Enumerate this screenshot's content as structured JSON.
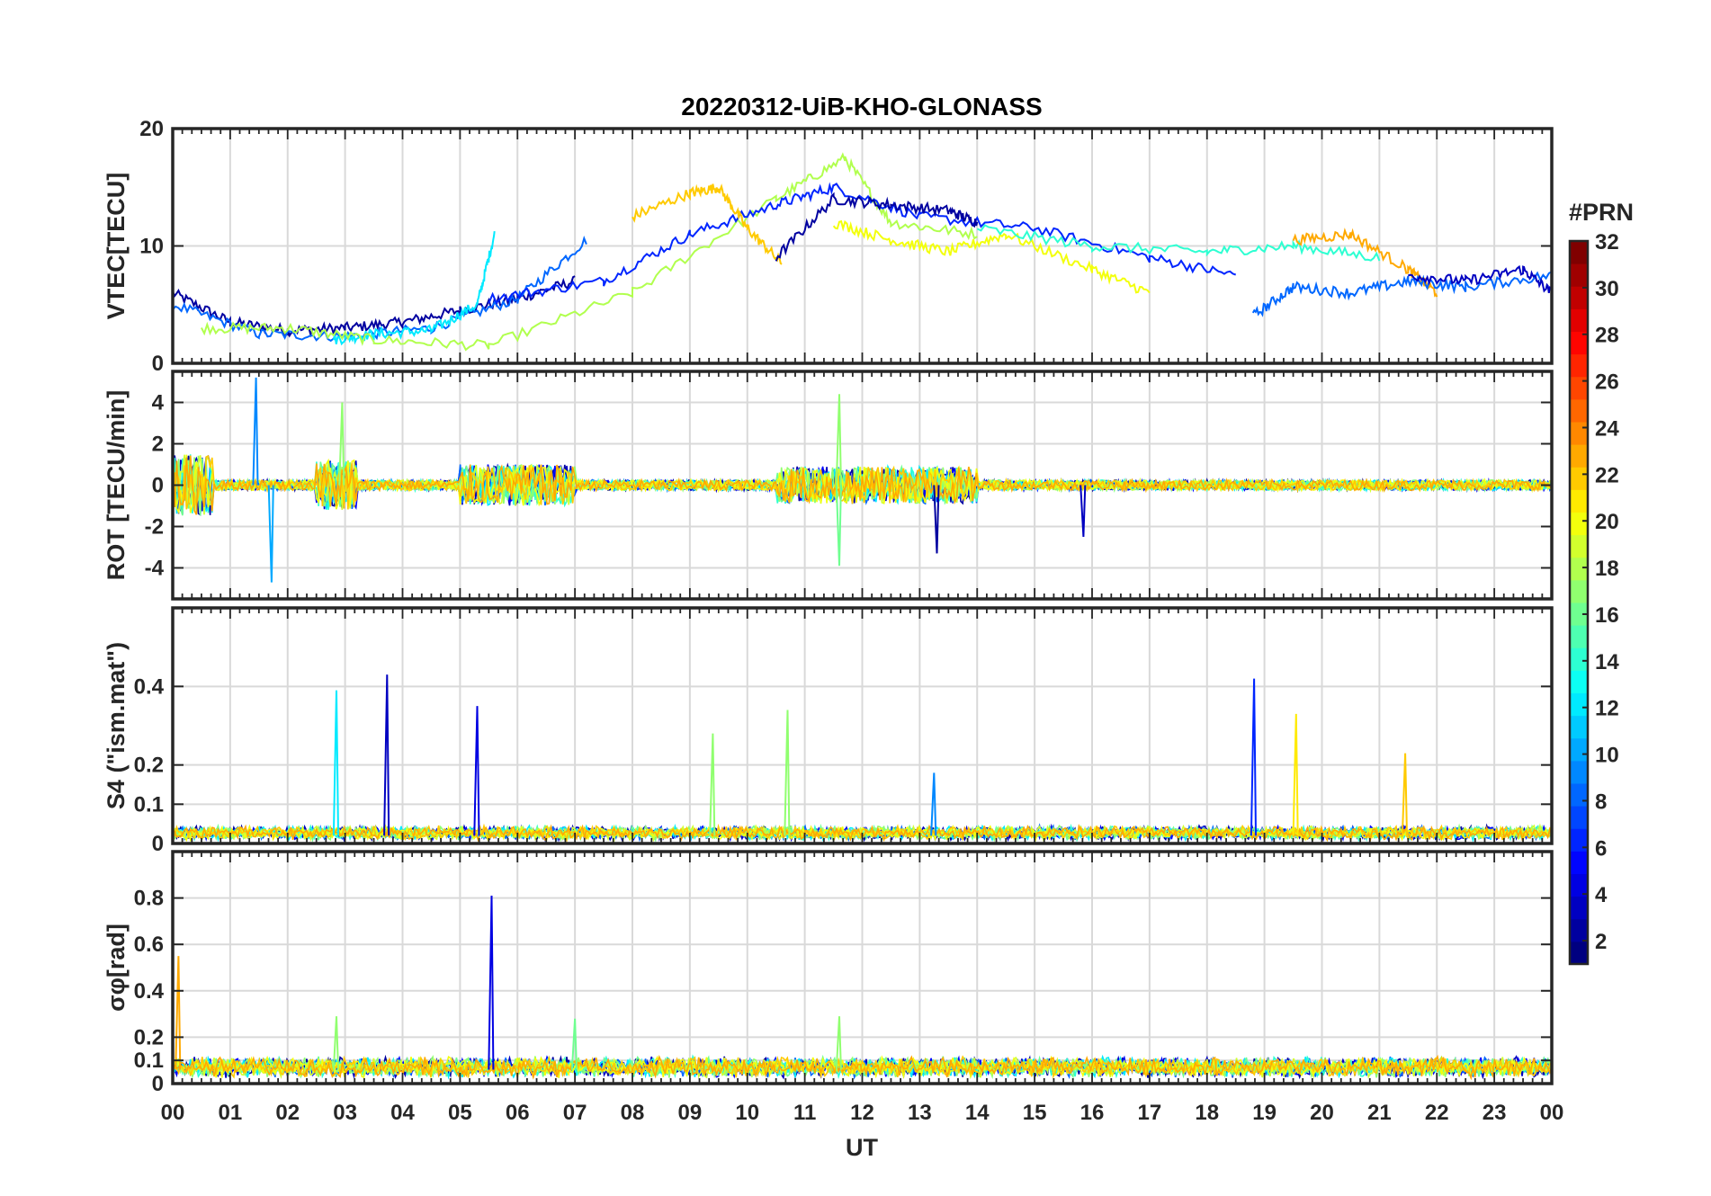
{
  "chart_data": {
    "type": "line",
    "title": "20220312-UiB-KHO-GLONASS",
    "xlabel": "UT",
    "x_tick_labels": [
      "00",
      "01",
      "02",
      "03",
      "04",
      "05",
      "06",
      "07",
      "08",
      "09",
      "10",
      "11",
      "12",
      "13",
      "14",
      "15",
      "16",
      "17",
      "18",
      "19",
      "20",
      "21",
      "22",
      "23",
      "00"
    ],
    "xlim_hours": [
      0,
      24
    ],
    "grid": true,
    "colorbar": {
      "label": "#PRN",
      "range": [
        1,
        32
      ],
      "tick_labels": [
        "2",
        "4",
        "6",
        "8",
        "10",
        "12",
        "14",
        "16",
        "18",
        "20",
        "22",
        "24",
        "26",
        "28",
        "30",
        "32"
      ],
      "colormap": "jet"
    },
    "panels": [
      {
        "id": "vtec",
        "ylabel": "VTEC[TECU]",
        "ylim": [
          0,
          20
        ],
        "y_ticks": [
          0,
          10,
          20
        ],
        "y_tick_labels": [
          "0",
          "10",
          "20"
        ],
        "series_shape": [
          {
            "prn": 2,
            "x": [
              0.0,
              1.0,
              2.0,
              3.0,
              4.0,
              5.0,
              6.0,
              7.0
            ],
            "y": [
              6,
              3.5,
              2.8,
              3.0,
              3.5,
              4.5,
              5.5,
              7
            ]
          },
          {
            "prn": 8,
            "x": [
              0.0,
              1.5,
              3.0,
              4.5,
              6.0,
              7.2
            ],
            "y": [
              5,
              2.5,
              2.3,
              3.0,
              5.5,
              10.5
            ]
          },
          {
            "prn": 12,
            "x": [
              2.8,
              3.5,
              4.5,
              5.3,
              5.6
            ],
            "y": [
              2.0,
              2.5,
              2.8,
              5.0,
              11
            ]
          },
          {
            "prn": 18,
            "x": [
              0.5,
              2.0,
              3.5,
              5.5,
              8.0,
              10.5,
              11.7,
              12.5,
              14.0
            ],
            "y": [
              3,
              3.0,
              2.0,
              1.5,
              6.0,
              14.0,
              17.5,
              12,
              11
            ]
          },
          {
            "prn": 6,
            "x": [
              5.5,
              7.5,
              9.0,
              10.5,
              11.5,
              13.0,
              15.0,
              17.0,
              18.5
            ],
            "y": [
              5.5,
              7.0,
              11.0,
              13.5,
              15.0,
              12.5,
              11.5,
              9.0,
              7.5
            ]
          },
          {
            "prn": 22,
            "x": [
              8.0,
              9.0,
              9.5,
              10.0,
              10.6
            ],
            "y": [
              12.5,
              14.5,
              15.0,
              11.5,
              8.5
            ]
          },
          {
            "prn": 2,
            "x": [
              10.5,
              11.5,
              12.5,
              13.5,
              14.0
            ],
            "y": [
              9,
              14,
              13.5,
              13.0,
              12
            ]
          },
          {
            "prn": 20,
            "x": [
              11.5,
              12.5,
              13.5,
              14.5,
              16.0,
              17.0
            ],
            "y": [
              12,
              10.5,
              9.5,
              11.0,
              8.0,
              6.0
            ]
          },
          {
            "prn": 14,
            "x": [
              14.0,
              16.0,
              18.0,
              19.5,
              21.0
            ],
            "y": [
              11.5,
              10.0,
              9.5,
              10.0,
              9.0
            ]
          },
          {
            "prn": 23,
            "x": [
              19.5,
              20.5,
              21.5,
              22.0
            ],
            "y": [
              10.5,
              11.0,
              8.0,
              6.0
            ]
          },
          {
            "prn": 8,
            "x": [
              18.8,
              19.5,
              20.5,
              21.5,
              22.5,
              24.0
            ],
            "y": [
              4,
              6.5,
              6.0,
              7.0,
              6.5,
              7.5
            ]
          },
          {
            "prn": 3,
            "x": [
              21.5,
              22.5,
              23.5,
              24.0
            ],
            "y": [
              7.5,
              7.0,
              8.0,
              6.0
            ]
          }
        ]
      },
      {
        "id": "rot",
        "ylabel": "ROT [TECU/min]",
        "ylim": [
          -5.5,
          5.5
        ],
        "y_ticks": [
          -4,
          -2,
          0,
          2,
          4
        ],
        "y_tick_labels": [
          "-4",
          "-2",
          "0",
          "2",
          "4"
        ],
        "noise_bands": [
          {
            "from": 0.0,
            "to": 0.7,
            "amplitude": 1.5
          },
          {
            "from": 2.5,
            "to": 3.2,
            "amplitude": 1.2
          },
          {
            "from": 5.0,
            "to": 7.0,
            "amplitude": 1.0
          },
          {
            "from": 10.5,
            "to": 14.0,
            "amplitude": 0.9
          }
        ],
        "spikes": [
          {
            "x": 1.45,
            "y": 5.2,
            "prn": 9
          },
          {
            "x": 1.72,
            "y": -4.7,
            "prn": 10
          },
          {
            "x": 2.95,
            "y": 4.0,
            "prn": 17
          },
          {
            "x": 11.6,
            "y": 4.4,
            "prn": 17
          },
          {
            "x": 11.6,
            "y": -3.9,
            "prn": 16
          },
          {
            "x": 13.3,
            "y": -3.3,
            "prn": 2
          },
          {
            "x": 15.85,
            "y": -2.5,
            "prn": 3
          }
        ]
      },
      {
        "id": "s4",
        "ylabel": "S4 (\"ism.mat\")",
        "ylim": [
          0,
          0.6
        ],
        "y_ticks": [
          0,
          0.1,
          0.2,
          0.4
        ],
        "y_tick_labels": [
          "0",
          "0.1",
          "0.2",
          "0.4"
        ],
        "baseline": 0.02,
        "spikes": [
          {
            "x": 2.85,
            "y": 0.39,
            "prn": 12
          },
          {
            "x": 3.73,
            "y": 0.43,
            "prn": 3
          },
          {
            "x": 5.3,
            "y": 0.35,
            "prn": 4
          },
          {
            "x": 9.4,
            "y": 0.28,
            "prn": 17
          },
          {
            "x": 10.7,
            "y": 0.34,
            "prn": 17
          },
          {
            "x": 13.25,
            "y": 0.18,
            "prn": 9
          },
          {
            "x": 18.82,
            "y": 0.42,
            "prn": 6
          },
          {
            "x": 19.55,
            "y": 0.33,
            "prn": 21
          },
          {
            "x": 21.45,
            "y": 0.23,
            "prn": 22
          }
        ]
      },
      {
        "id": "sigma_phi",
        "ylabel": "σφ[rad]",
        "ylim": [
          0,
          1.0
        ],
        "y_ticks": [
          0,
          0.1,
          0.2,
          0.4,
          0.6,
          0.8
        ],
        "y_tick_labels": [
          "0",
          "0.1",
          "0.2",
          "0.4",
          "0.6",
          "0.8"
        ],
        "baseline": 0.06,
        "spikes": [
          {
            "x": 0.1,
            "y": 0.55,
            "prn": 23
          },
          {
            "x": 5.55,
            "y": 0.81,
            "prn": 4
          },
          {
            "x": 2.85,
            "y": 0.29,
            "prn": 17
          },
          {
            "x": 11.6,
            "y": 0.29,
            "prn": 17
          },
          {
            "x": 7.0,
            "y": 0.28,
            "prn": 16
          }
        ]
      }
    ]
  }
}
